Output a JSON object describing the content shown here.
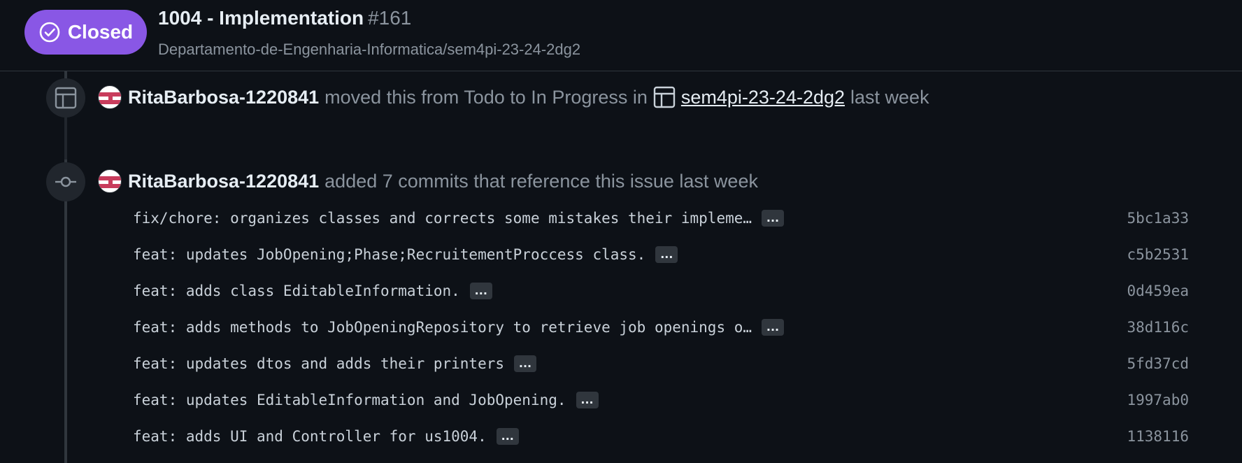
{
  "header": {
    "state_label": "Closed",
    "title": "1004 - Implementation",
    "number": "#161",
    "repo": "Departamento-de-Engenharia-Informatica/sem4pi-23-24-2dg2"
  },
  "events": [
    {
      "icon": "project-table-icon",
      "author": "RitaBarbosa-1220841",
      "text": "moved this from Todo to In Progress in",
      "project": "sem4pi-23-24-2dg2",
      "time": "last week"
    },
    {
      "icon": "git-commit-icon",
      "author": "RitaBarbosa-1220841",
      "text": "added 7 commits that reference this issue last week"
    }
  ],
  "commits": [
    {
      "message": "fix/chore: organizes classes and corrects some mistakes their impleme…",
      "sha": "5bc1a33"
    },
    {
      "message": "feat: updates JobOpening;Phase;RecruitementProccess class.",
      "sha": "c5b2531"
    },
    {
      "message": "feat: adds class EditableInformation.",
      "sha": "0d459ea"
    },
    {
      "message": "feat: adds methods to JobOpeningRepository to retrieve job openings o…",
      "sha": "38d116c"
    },
    {
      "message": "feat: updates dtos and adds their printers",
      "sha": "5fd37cd"
    },
    {
      "message": "feat: updates EditableInformation and JobOpening.",
      "sha": "1997ab0"
    },
    {
      "message": "feat: adds UI and Controller for us1004.",
      "sha": "1138116"
    }
  ],
  "ellipsis_label": "...",
  "colors": {
    "background": "#0d1117",
    "closed_badge": "#8957e5",
    "muted_text": "#8b949e",
    "primary_text": "#e6edf3"
  }
}
